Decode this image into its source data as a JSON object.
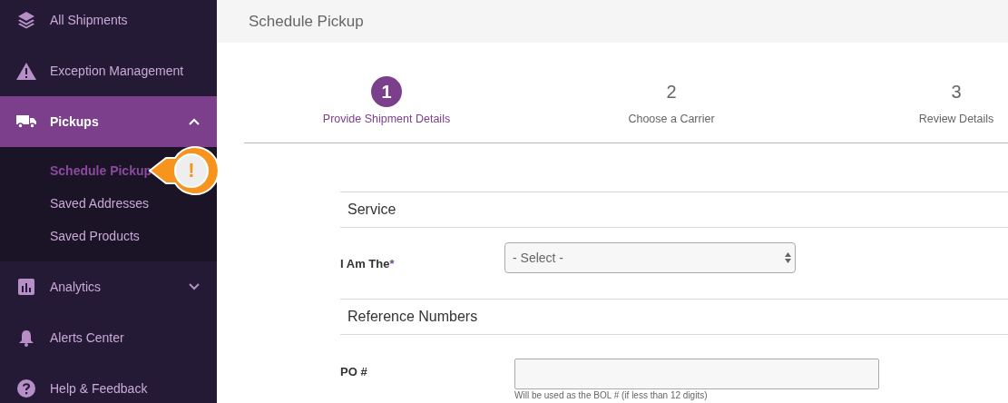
{
  "sidebar": {
    "items": [
      {
        "label": "All Shipments",
        "selected": false
      },
      {
        "label": "Exception Management",
        "selected": false
      },
      {
        "label": "Pickups",
        "selected": true,
        "expanded": true,
        "children": [
          {
            "label": "Schedule Pickup",
            "selected": true
          },
          {
            "label": "Saved Addresses",
            "selected": false
          },
          {
            "label": "Saved Products",
            "selected": false
          }
        ]
      },
      {
        "label": "Analytics",
        "selected": false,
        "expanded": false
      },
      {
        "label": "Alerts Center",
        "selected": false
      },
      {
        "label": "Help & Feedback",
        "selected": false
      }
    ]
  },
  "callout": {
    "glyph": "!"
  },
  "header": {
    "title": "Schedule Pickup"
  },
  "steps": [
    {
      "number": "1",
      "label": "Provide Shipment Details",
      "selected": true
    },
    {
      "number": "2",
      "label": "Choose a Carrier",
      "selected": false
    },
    {
      "number": "3",
      "label": "Review Details",
      "selected": false
    }
  ],
  "sections": [
    {
      "title": "Service",
      "fields": [
        {
          "kind": "select",
          "label": "I Am The",
          "required_mark": "*",
          "value": "- Select -"
        }
      ]
    },
    {
      "title": "Reference Numbers",
      "fields": [
        {
          "kind": "text",
          "label": "PO #",
          "hint": "Will be used as the BOL # (if less than 12 digits)"
        }
      ]
    }
  ]
}
